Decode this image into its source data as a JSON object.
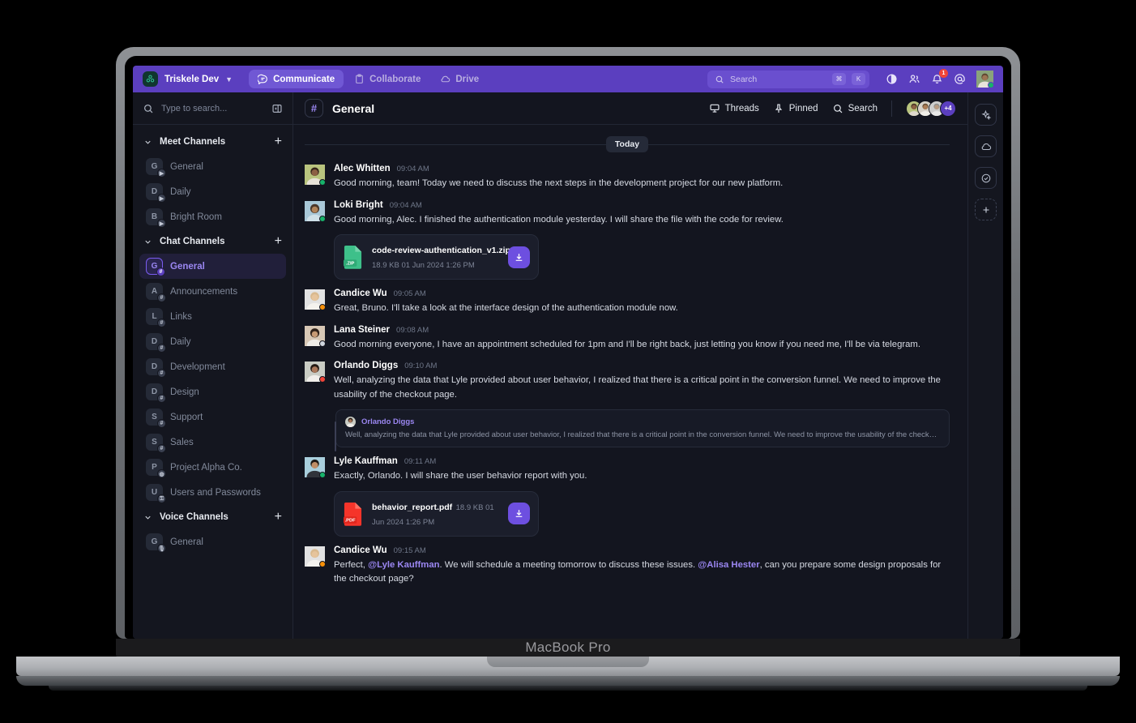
{
  "device": {
    "label": "MacBook Pro"
  },
  "topbar": {
    "brand": {
      "name": "Triskele Dev",
      "logo_icon": "triskele-logo",
      "chevron_icon": "chevron-down-icon"
    },
    "tabs": [
      {
        "label": "Communicate",
        "icon": "chat-bubble-icon",
        "active": true
      },
      {
        "label": "Collaborate",
        "icon": "clipboard-icon",
        "active": false
      },
      {
        "label": "Drive",
        "icon": "cloud-icon",
        "active": false
      }
    ],
    "search": {
      "placeholder": "Search",
      "icon": "search-icon",
      "shortcut": [
        "⌘",
        "K"
      ]
    },
    "icons": [
      {
        "name": "contrast-icon",
        "label": "Theme"
      },
      {
        "name": "people-icon",
        "label": "Members"
      },
      {
        "name": "bell-icon",
        "label": "Notifications",
        "badge": "1"
      },
      {
        "name": "at-mention-icon",
        "label": "Mentions"
      }
    ],
    "user": {
      "status": "online"
    },
    "accent": "#5b3fbf"
  },
  "sidebar": {
    "search": {
      "placeholder": "Type to search...",
      "icon": "search-icon"
    },
    "collapse_icon": "panel-collapse-icon",
    "groups": [
      {
        "title": "Meet Channels",
        "chevron_icon": "chevron-down-icon",
        "add_icon": "plus-icon",
        "channels": [
          {
            "label": "General",
            "initial": "G",
            "badge": "video",
            "active": false
          },
          {
            "label": "Daily",
            "initial": "D",
            "badge": "video",
            "active": false
          },
          {
            "label": "Bright Room",
            "initial": "B",
            "badge": "video",
            "active": false
          }
        ]
      },
      {
        "title": "Chat Channels",
        "chevron_icon": "chevron-down-icon",
        "add_icon": "plus-icon",
        "channels": [
          {
            "label": "General",
            "initial": "G",
            "badge": "hash",
            "active": true
          },
          {
            "label": "Announcements",
            "initial": "A",
            "badge": "hash",
            "active": false
          },
          {
            "label": "Links",
            "initial": "L",
            "badge": "hash",
            "active": false
          },
          {
            "label": "Daily",
            "initial": "D",
            "badge": "hash",
            "active": false
          },
          {
            "label": "Development",
            "initial": "D",
            "badge": "hash",
            "active": false
          },
          {
            "label": "Design",
            "initial": "D",
            "badge": "hash",
            "active": false
          },
          {
            "label": "Support",
            "initial": "S",
            "badge": "hash",
            "active": false
          },
          {
            "label": "Sales",
            "initial": "S",
            "badge": "hash",
            "active": false
          },
          {
            "label": "Project Alpha Co.",
            "initial": "P",
            "badge": "globe",
            "active": false
          },
          {
            "label": "Users and Passwords",
            "initial": "U",
            "badge": "lock",
            "active": false
          }
        ]
      },
      {
        "title": "Voice Channels",
        "chevron_icon": "chevron-down-icon",
        "add_icon": "plus-icon",
        "channels": [
          {
            "label": "General",
            "initial": "G",
            "badge": "mic",
            "active": false
          }
        ]
      }
    ]
  },
  "channel_header": {
    "hash_icon": "hash-icon",
    "title": "General",
    "actions": [
      {
        "label": "Threads",
        "icon": "threads-icon"
      },
      {
        "label": "Pinned",
        "icon": "pin-icon"
      },
      {
        "label": "Search",
        "icon": "search-icon"
      }
    ],
    "members_more": "+4"
  },
  "conversation": {
    "day_separator": "Today",
    "messages": [
      {
        "author": "Alec Whitten",
        "time": "09:04 AM",
        "status": "online",
        "text": "Good morning, team! Today we need to discuss the next steps in the development project for our new platform."
      },
      {
        "author": "Loki Bright",
        "time": "09:04 AM",
        "status": "online",
        "text": "Good morning, Alec. I finished the authentication module yesterday. I will share the file with the code for review.",
        "attachment": {
          "name": "code-review-authentication_v1.zip",
          "meta": "18.9 KB 01 Jun 2024 1:26 PM",
          "kind": "zip",
          "ext_label": ".ZIP",
          "color": "#3ec08a",
          "download_icon": "download-icon"
        }
      },
      {
        "author": "Candice Wu",
        "time": "09:05 AM",
        "status": "away",
        "text": "Great, Bruno. I'll take a look at the interface design of the authentication module now."
      },
      {
        "author": "Lana Steiner",
        "time": "09:08 AM",
        "status": "offline",
        "text": "Good morning everyone, I have an appointment scheduled for 1pm and I'll be right back, just letting you know if you need me, I'll be via telegram."
      },
      {
        "author": "Orlando Diggs",
        "time": "09:10 AM",
        "status": "busy",
        "text": "Well, analyzing the data that Lyle provided about user behavior, I realized that there is a critical point in the conversion funnel. We need to improve the usability of the checkout page.",
        "quote": {
          "author": "Orlando Diggs",
          "text": "Well, analyzing the data that Lyle provided about user behavior, I realized that there is a critical point in the conversion funnel. We need to improve the usability of the checkout p..."
        }
      },
      {
        "author": "Lyle Kauffman",
        "time": "09:11 AM",
        "status": "online",
        "text": "Exactly, Orlando. I will share the user behavior report with you.",
        "attachment": {
          "name": "behavior_report.pdf",
          "meta": "18.9 KB 01 Jun 2024 1:26 PM",
          "kind": "pdf",
          "ext_label": ".PDF",
          "color": "#f5342a",
          "download_icon": "download-icon"
        }
      },
      {
        "author": "Candice Wu",
        "time": "09:15 AM",
        "status": "away",
        "rich": [
          {
            "t": "Perfect, "
          },
          {
            "t": "@Lyle Kauffman",
            "mention": true
          },
          {
            "t": ". We will schedule a meeting tomorrow to discuss these issues. "
          },
          {
            "t": "@Alisa Hester",
            "mention": true
          },
          {
            "t": ", can you prepare some design proposals for the checkout page?"
          }
        ]
      }
    ]
  },
  "rail": {
    "buttons": [
      {
        "name": "sparkles-icon",
        "label": "AI Assistant"
      },
      {
        "name": "cloud-icon",
        "label": "Drive"
      },
      {
        "name": "check-circle-icon",
        "label": "Tasks"
      },
      {
        "name": "plus-icon",
        "label": "Add",
        "dashed": true
      }
    ]
  }
}
